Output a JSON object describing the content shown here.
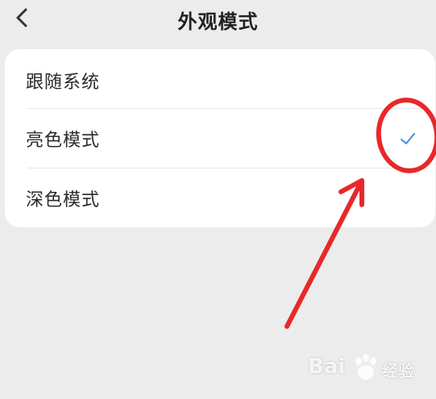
{
  "header": {
    "title": "外观模式",
    "back_icon": "chevron-left-icon"
  },
  "options": [
    {
      "label": "跟随系统",
      "selected": false
    },
    {
      "label": "亮色模式",
      "selected": true
    },
    {
      "label": "深色模式",
      "selected": false
    }
  ],
  "colors": {
    "background": "#ececec",
    "card": "#ffffff",
    "check": "#3d8fd6",
    "annotation": "#e8282a"
  },
  "watermark": {
    "brand": "Bai",
    "suffix": "经验",
    "logo_icon": "baidu-paw-icon"
  }
}
